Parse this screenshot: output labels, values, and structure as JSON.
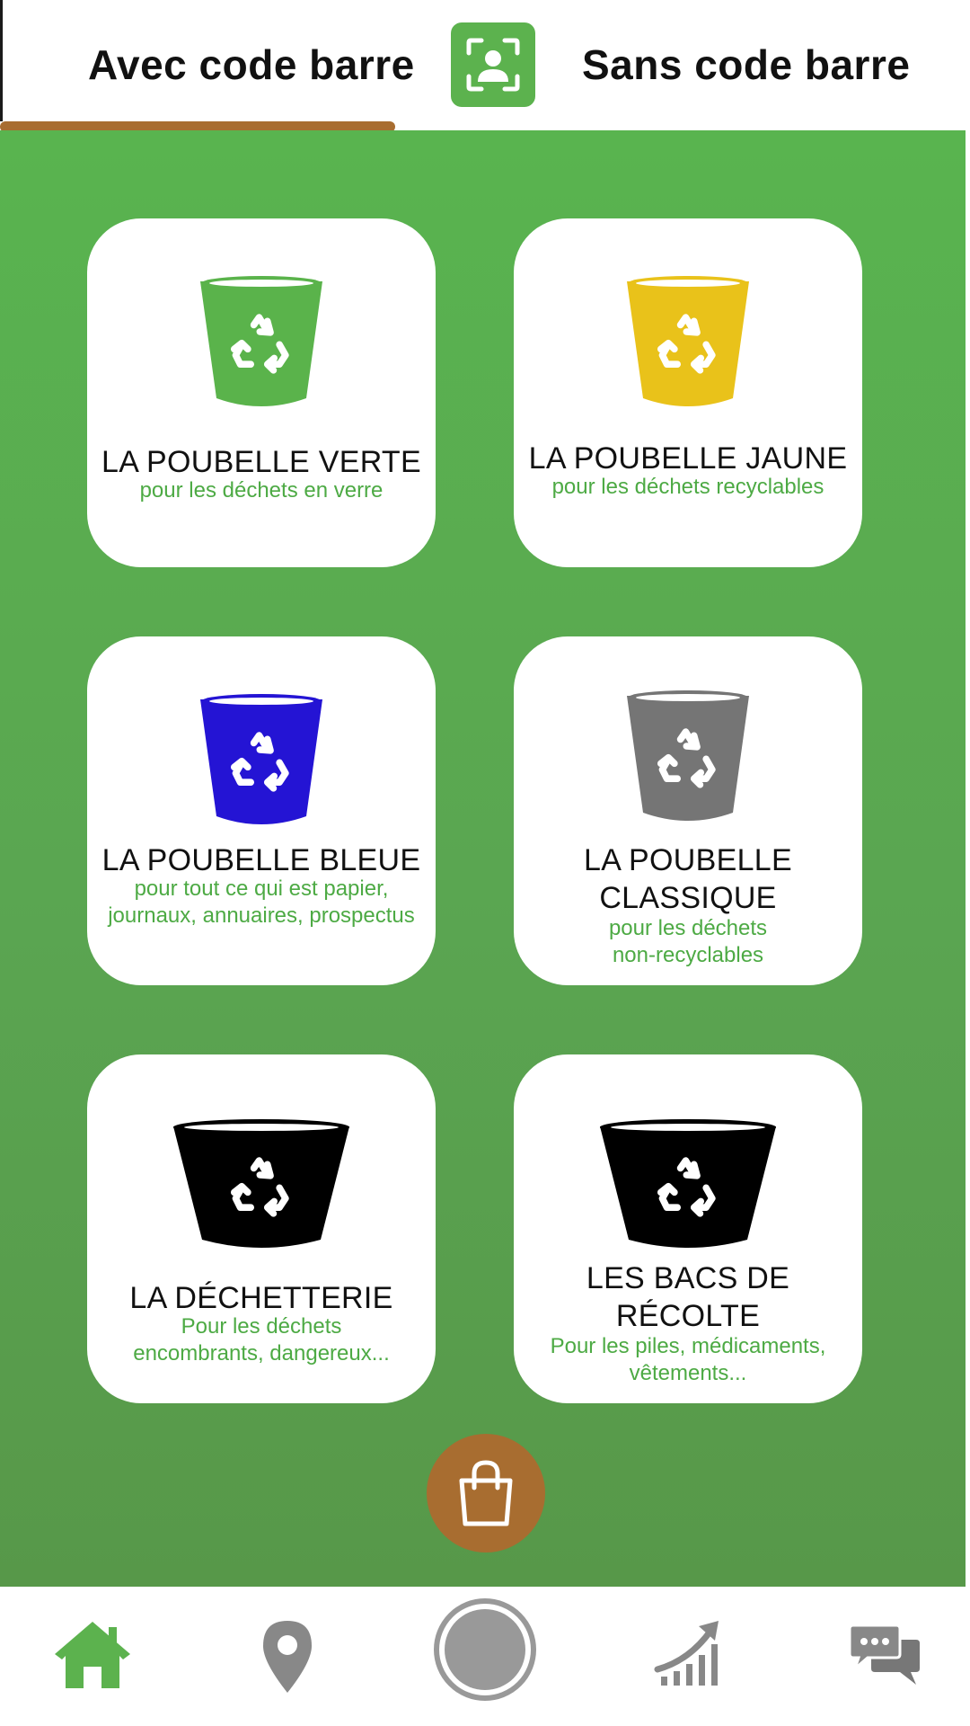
{
  "tabs": {
    "left_label": "Avec code barre",
    "right_label": "Sans code barre",
    "active": "left"
  },
  "icons": {
    "scan": "face-scan-icon",
    "bag": "shopping-bag-icon",
    "recycle": "recycle-icon"
  },
  "colors": {
    "brand_green": "#5cb24e",
    "accent_brown": "#a86d30",
    "subtitle_green": "#4daa44",
    "inactive_nav": "#888888"
  },
  "bins": [
    {
      "title": "LA POUBELLE VERTE",
      "subtitle": "pour les déchets en verre",
      "color": "#5ab34b"
    },
    {
      "title": "LA POUBELLE JAUNE",
      "subtitle": "pour les déchets recyclables",
      "color": "#e9c21a"
    },
    {
      "title": "LA POUBELLE BLEUE",
      "subtitle": "pour tout ce qui est papier, journaux, annuaires, prospectus",
      "color": "#2414d4"
    },
    {
      "title": "LA POUBELLE CLASSIQUE",
      "subtitle": "pour les déchets non-recyclables",
      "color": "#757575"
    },
    {
      "title": "LA DÉCHETTERIE",
      "subtitle": "Pour les déchets encombrants, dangereux...",
      "color": "#000000"
    },
    {
      "title": "LES BACS DE RÉCOLTE",
      "subtitle": "Pour les piles, médicaments, vêtements...",
      "color": "#000000"
    }
  ],
  "nav": [
    {
      "icon": "home-icon",
      "active": true
    },
    {
      "icon": "map-pin-icon",
      "active": false
    },
    {
      "icon": "camera-shutter-icon",
      "active": false
    },
    {
      "icon": "stats-growth-icon",
      "active": false
    },
    {
      "icon": "chat-icon",
      "active": false
    }
  ]
}
